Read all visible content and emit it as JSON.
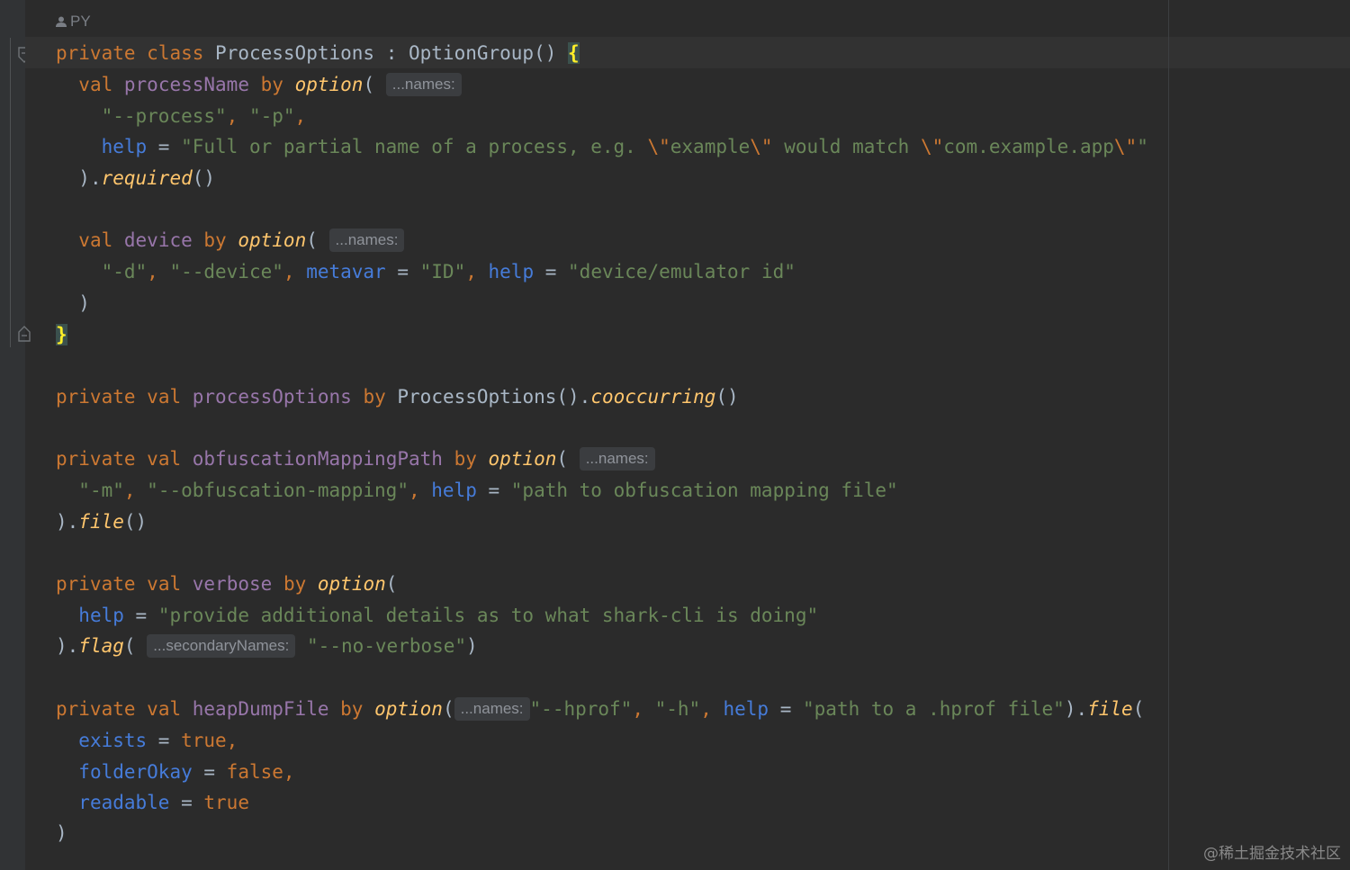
{
  "author_label": "PY",
  "code": {
    "l1": {
      "private": "private",
      "class": "class",
      "name": "ProcessOptions",
      "colon": " : ",
      "super": "OptionGroup()",
      "brace": "{"
    },
    "l2": {
      "val": "val",
      "prop": "processName",
      "by": "by",
      "fn": "option",
      "paren": "(",
      "hint": "...names:"
    },
    "l3": {
      "s1": "\"--process\"",
      "comma": ", ",
      "s2": "\"-p\"",
      "comma2": ","
    },
    "l4": {
      "param": "help",
      "eq": " = ",
      "s_a": "\"Full or partial name of a process, e.g. ",
      "esc1": "\\\"",
      "s_b": "example",
      "esc2": "\\\"",
      "s_c": " would match ",
      "esc3": "\\\"",
      "s_d": "com.example.app",
      "esc4": "\\\"",
      "s_e": "\""
    },
    "l5": {
      "close": ").",
      "fn": "required",
      "parens": "()"
    },
    "l6": {
      "val": "val",
      "prop": "device",
      "by": "by",
      "fn": "option",
      "paren": "(",
      "hint": "...names:"
    },
    "l7": {
      "s1": "\"-d\"",
      "c1": ", ",
      "s2": "\"--device\"",
      "c2": ", ",
      "p1": "metavar",
      "eq1": " = ",
      "s3": "\"ID\"",
      "c3": ", ",
      "p2": "help",
      "eq2": " = ",
      "s4": "\"device/emulator id\""
    },
    "l8": {
      "close": ")"
    },
    "l9": {
      "brace": "}"
    },
    "l10": {
      "private": "private",
      "val": "val",
      "prop": "processOptions",
      "by": "by",
      "cls": "ProcessOptions().",
      "fn": "cooccurring",
      "parens": "()"
    },
    "l11": {
      "private": "private",
      "val": "val",
      "prop": "obfuscationMappingPath",
      "by": "by",
      "fn": "option",
      "paren": "(",
      "hint": "...names:"
    },
    "l12": {
      "s1": "\"-m\"",
      "c1": ", ",
      "s2": "\"--obfuscation-mapping\"",
      "c2": ", ",
      "p": "help",
      "eq": " = ",
      "s3": "\"path to obfuscation mapping file\""
    },
    "l13": {
      "close": ").",
      "fn": "file",
      "parens": "()"
    },
    "l14": {
      "private": "private",
      "val": "val",
      "prop": "verbose",
      "by": "by",
      "fn": "option",
      "paren": "("
    },
    "l15": {
      "p": "help",
      "eq": " = ",
      "s": "\"provide additional details as to what shark-cli is doing\""
    },
    "l16": {
      "close": ").",
      "fn": "flag",
      "paren": "(",
      "hint": "...secondaryNames:",
      "s": "\"--no-verbose\"",
      "end": ")"
    },
    "l17": {
      "private": "private",
      "val": "val",
      "prop": "heapDumpFile",
      "by": "by",
      "fn": "option",
      "paren": "(",
      "hint": "...names:",
      "s1": "\"--hprof\"",
      "c1": ", ",
      "s2": "\"-h\"",
      "c2": ", ",
      "p": "help",
      "eq": " = ",
      "s3": "\"path to a .hprof file\"",
      "close": ").",
      "fn2": "file",
      "paren2": "("
    },
    "l18": {
      "p": "exists",
      "eq": " = ",
      "v": "true",
      "c": ","
    },
    "l19": {
      "p": "folderOkay",
      "eq": " = ",
      "v": "false",
      "c": ","
    },
    "l20": {
      "p": "readable",
      "eq": " = ",
      "v": "true"
    },
    "l21": {
      "close": ")"
    }
  },
  "watermark": "@稀土掘金技术社区",
  "colors": {
    "background": "#2b2b2b",
    "gutter": "#313335",
    "keyword": "#cc7832",
    "property": "#9876aa",
    "function": "#ffc66d",
    "string": "#6a8759",
    "named_param": "#467cda",
    "default_text": "#a9b7c6",
    "inlay_hint_bg": "#3b3d40"
  }
}
